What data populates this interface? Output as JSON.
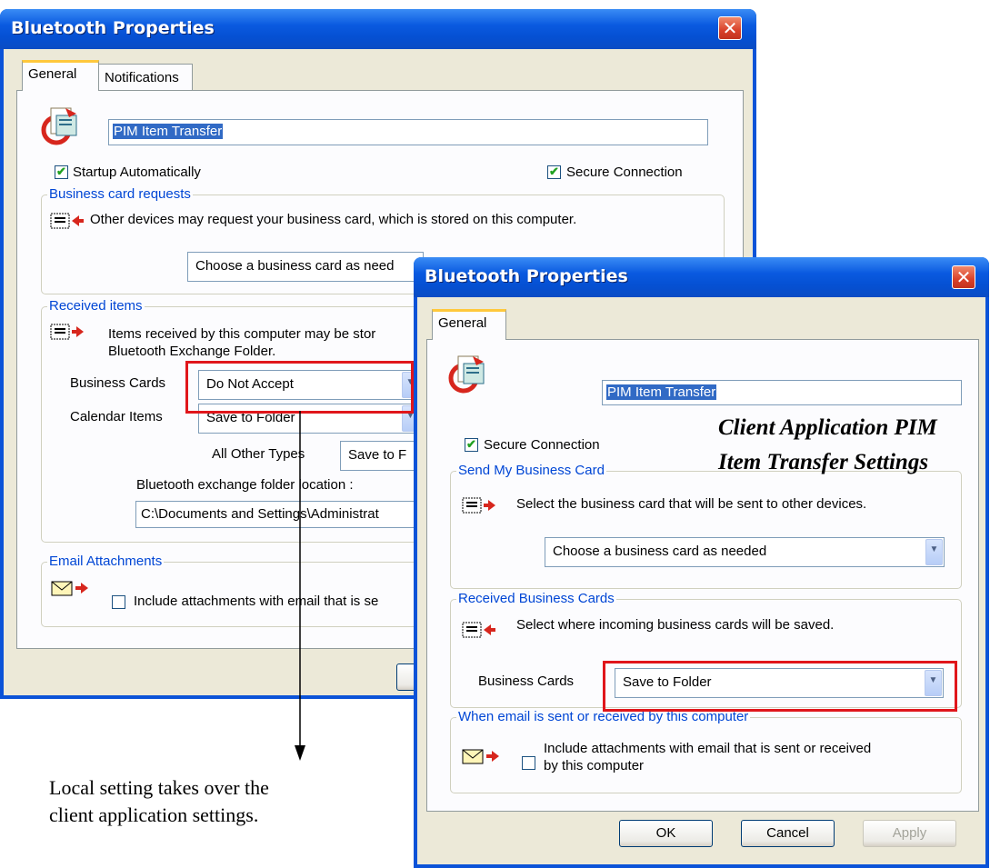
{
  "back_window": {
    "title": "Bluetooth Properties",
    "tabs": [
      "General",
      "Notifications"
    ],
    "service_name": "PIM Item Transfer",
    "startup_label": "Startup Automatically",
    "secure_label": "Secure Connection",
    "business_card_requests": {
      "legend": "Business card requests",
      "text": "Other devices may request your business card, which is stored on this computer.",
      "combo_value": "Choose a business card as need"
    },
    "received_items": {
      "legend": "Received items",
      "text_line1": "Items received by this computer may be stor",
      "text_line2": "Bluetooth Exchange Folder.",
      "business_cards_label": "Business Cards",
      "business_cards_value": "Do Not Accept",
      "calendar_label": "Calendar Items",
      "calendar_value": "Save to Folder",
      "other_label": "All Other Types",
      "other_value": "Save to F",
      "folder_label": "Bluetooth exchange folder location :",
      "folder_value": "C:\\Documents and Settings\\Administrat"
    },
    "email": {
      "legend": "Email Attachments",
      "text": "Include attachments with email that is se"
    }
  },
  "front_window": {
    "title": "Bluetooth Properties",
    "tabs": [
      "General"
    ],
    "service_name": "PIM Item Transfer",
    "secure_label": "Secure Connection",
    "send_card": {
      "legend": "Send My Business Card",
      "text": "Select the business card that will be sent to other devices.",
      "combo_value": "Choose a business card as needed"
    },
    "received_cards": {
      "legend": "Received Business Cards",
      "text": "Select where incoming business cards will be saved.",
      "label": "Business Cards",
      "value": "Save to Folder"
    },
    "email": {
      "legend": "When email is sent or received by this computer",
      "text_line1": "Include attachments with email that is sent or received",
      "text_line2": "by this computer"
    },
    "buttons": {
      "ok": "OK",
      "cancel": "Cancel",
      "apply": "Apply"
    }
  },
  "annotations": {
    "client_line1": "Client Application PIM",
    "client_line2": "Item Transfer Settings",
    "local_line1": "Local setting takes over the",
    "local_line2": "client application settings."
  },
  "colors": {
    "highlight_box": "#e0161b",
    "legend_text": "#0046d5",
    "titlebar": "#0550d3"
  }
}
